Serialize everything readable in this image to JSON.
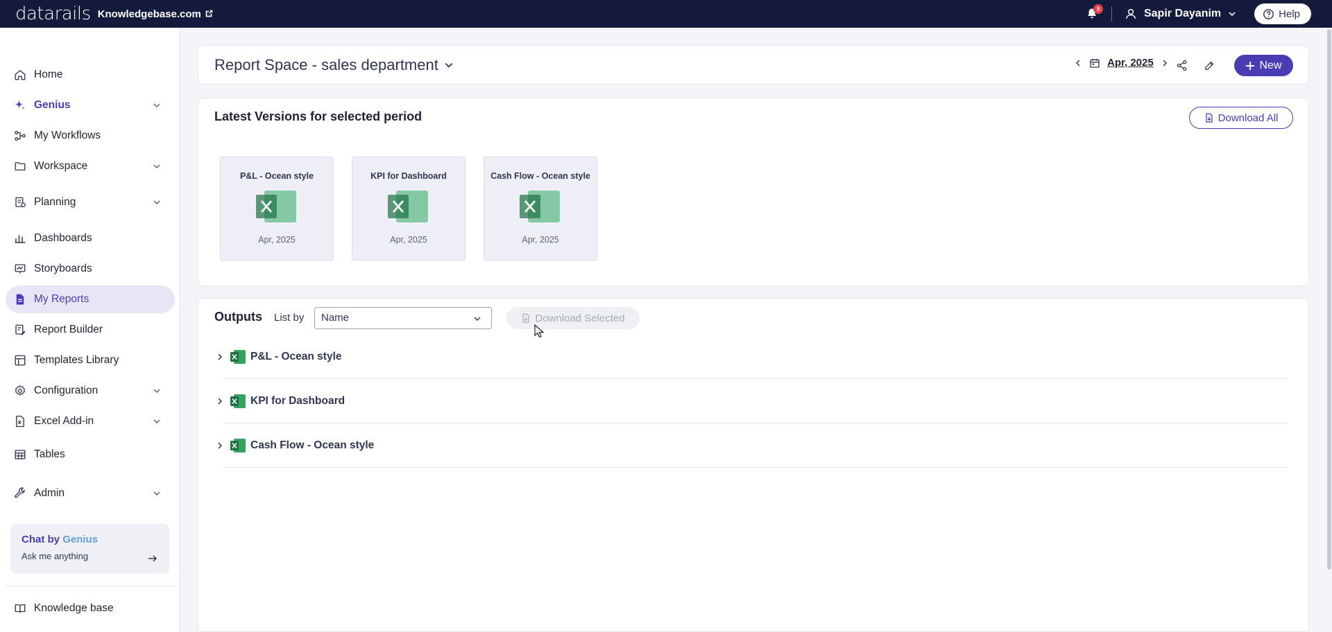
{
  "topbar": {
    "logo": "datarails",
    "kb_link": "Knowledgebase.com",
    "notifications_count": "8",
    "user_name": "Sapir Dayanim",
    "help_label": "Help"
  },
  "sidebar": {
    "items": [
      {
        "label": "Home",
        "icon": "home-icon"
      },
      {
        "label": "Genius",
        "icon": "sparkle-icon"
      },
      {
        "label": "My Workflows",
        "icon": "workflow-icon"
      },
      {
        "label": "Workspace",
        "icon": "folder-icon"
      },
      {
        "label": "Planning",
        "icon": "planning-icon"
      },
      {
        "label": "Dashboards",
        "icon": "bar-chart-icon"
      },
      {
        "label": "Storyboards",
        "icon": "presentation-icon"
      },
      {
        "label": "My Reports",
        "icon": "report-icon"
      },
      {
        "label": "Report Builder",
        "icon": "report-builder-icon"
      },
      {
        "label": "Templates Library",
        "icon": "templates-icon"
      },
      {
        "label": "Configuration",
        "icon": "gear-icon"
      },
      {
        "label": "Excel Add-in",
        "icon": "excel-addin-icon"
      },
      {
        "label": "Tables",
        "icon": "table-icon"
      },
      {
        "label": "Admin",
        "icon": "wrench-icon"
      }
    ],
    "chat": {
      "title_prefix": "Chat by",
      "title_brand": "Genius",
      "subtitle": "Ask me anything"
    },
    "knowledge_base": "Knowledge base"
  },
  "header": {
    "title": "Report Space - sales department",
    "period": "Apr, 2025",
    "new_label": "New"
  },
  "versions": {
    "title": "Latest Versions for selected period",
    "download_all": "Download All",
    "tiles": [
      {
        "name": "P&L - Ocean style",
        "date": "Apr, 2025"
      },
      {
        "name": "KPI for Dashboard",
        "date": "Apr, 2025"
      },
      {
        "name": "Cash Flow - Ocean style",
        "date": "Apr, 2025"
      }
    ]
  },
  "outputs": {
    "title": "Outputs",
    "list_by_label": "List by",
    "list_by_value": "Name",
    "download_selected": "Download Selected",
    "rows": [
      {
        "name": "P&L - Ocean style"
      },
      {
        "name": "KPI for Dashboard"
      },
      {
        "name": "Cash Flow - Ocean style"
      }
    ]
  },
  "colors": {
    "topbar_bg": "#131a3b",
    "accent": "#4a3cb3",
    "active_nav_bg": "#e8e6f6",
    "excel_green": "#1e7145"
  }
}
